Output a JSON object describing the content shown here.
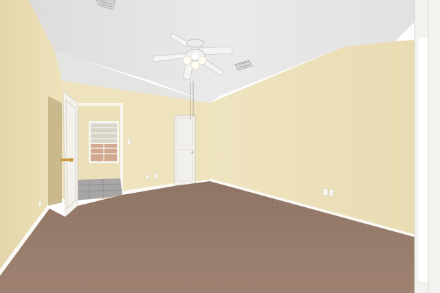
{
  "photo": {
    "subject": "empty-bedroom-interior",
    "colors": {
      "wall": "#eee2bb",
      "wall_shadow": "#e3d5aa",
      "ceiling": "#e6e6e6",
      "carpet": "#9a7d6c",
      "trim": "#f7f4ec",
      "door": "#f2f0ea"
    },
    "icons": {
      "ceiling_fan": "ceiling-fan-icon",
      "air_vent": "air-vent-icon",
      "window": "window-icon",
      "door": "door-icon",
      "outlet": "outlet-icon"
    }
  }
}
